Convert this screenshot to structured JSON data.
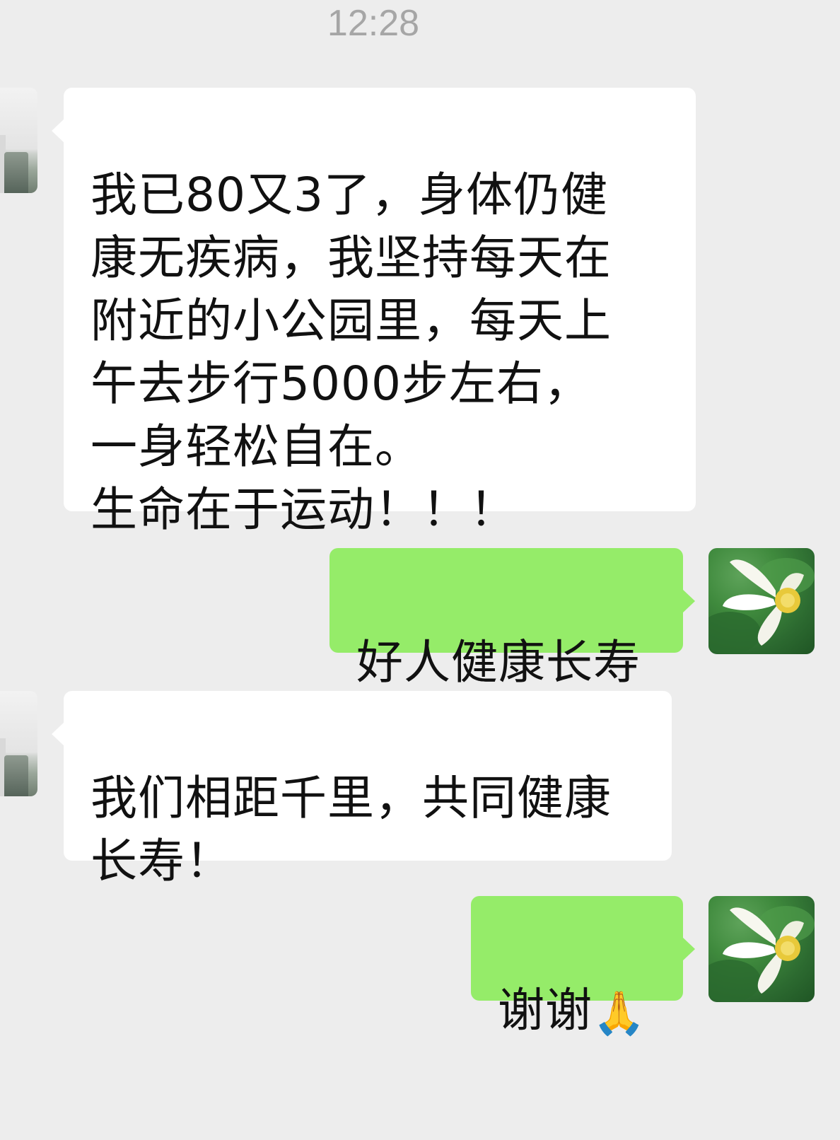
{
  "chat": {
    "timestamp": "12:28",
    "messages": [
      {
        "sender": "contact",
        "text": "我已80又3了，身体仍健\n康无疾病，我坚持每天在\n附近的小公园里，每天上\n午去步行5000步左右，\n一身轻松自在。\n生命在于运动！！！"
      },
      {
        "sender": "me",
        "text": "好人健康长寿"
      },
      {
        "sender": "contact",
        "text": "我们相距千里，共同健康\n长寿！"
      },
      {
        "sender": "me",
        "text": "谢谢",
        "emoji": "🙏"
      }
    ]
  },
  "avatars": {
    "contact": "building-photo-avatar",
    "me": "lotus-flower-avatar"
  },
  "colors": {
    "background": "#ededed",
    "incoming_bubble": "#ffffff",
    "outgoing_bubble": "#95ec69",
    "timestamp_text": "#a6a6a6"
  }
}
